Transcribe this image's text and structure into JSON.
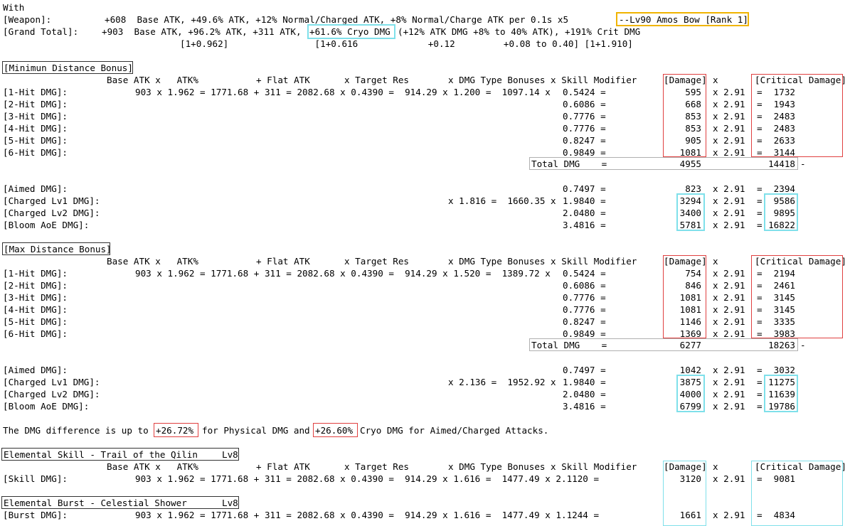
{
  "header": {
    "with": "With",
    "weapon_label": "[Weapon]:",
    "weapon_value": "+608  Base ATK, +49.6% ATK, +12% Normal/Charged ATK, +8% Normal/Charge ATK per 0.1s x5",
    "weapon_name": "--Lv90 Amos Bow [Rank 1]",
    "grand_label": "[Grand Total]:",
    "grand_a": "+903  Base ATK, +96.2% ATK, +311 ATK,",
    "grand_cryo": "+61.6% Cryo DMG",
    "grand_b": "(+12% ATK DMG +8% to 40% ATK), +191% Crit DMG",
    "mult_line": "[1+0.962]                [1+0.616             +0.12         +0.08 to 0.40] [1+1.910]"
  },
  "columns": {
    "base": "Base ATK x   ATK%",
    "flat": "+ Flat ATK",
    "res": "x Target Res",
    "dmgtype": "x DMG Type Bonuses x Skill Modifier",
    "damage": "[Damage]",
    "x": "x",
    "crit": "[Critical Damage]"
  },
  "sections": {
    "min": {
      "title": "[Minimun Distance Bonus]",
      "calc": "903 x 1.962 = 1771.68 + 311 = 2082.68 x 0.4390 =  914.29 x 1.200 =  1097.14 x",
      "rows": [
        {
          "label": "[1-Hit DMG]:",
          "mod": "0.5424 =",
          "dmg": "595",
          "mul": "x 2.91",
          "eq": "=",
          "crit": "1732"
        },
        {
          "label": "[2-Hit DMG]:",
          "mod": "0.6086 =",
          "dmg": "668",
          "mul": "x 2.91",
          "eq": "=",
          "crit": "1943"
        },
        {
          "label": "[3-Hit DMG]:",
          "mod": "0.7776 =",
          "dmg": "853",
          "mul": "x 2.91",
          "eq": "=",
          "crit": "2483"
        },
        {
          "label": "[4-Hit DMG]:",
          "mod": "0.7776 =",
          "dmg": "853",
          "mul": "x 2.91",
          "eq": "=",
          "crit": "2483"
        },
        {
          "label": "[5-Hit DMG]:",
          "mod": "0.8247 =",
          "dmg": "905",
          "mul": "x 2.91",
          "eq": "=",
          "crit": "2633"
        },
        {
          "label": "[6-Hit DMG]:",
          "mod": "0.9849 =",
          "dmg": "1081",
          "mul": "x 2.91",
          "eq": "=",
          "crit": "3144"
        }
      ],
      "total": {
        "label": "Total DMG    =",
        "dmg": "4955",
        "crit": "14418",
        "dash": "-"
      },
      "charged_calc": "x 1.816 =  1660.35 x",
      "charged": [
        {
          "label": "[Aimed DMG]:",
          "mod": "0.7497 =",
          "dmg": "823",
          "mul": "x 2.91",
          "eq": "=",
          "crit": "2394"
        },
        {
          "label": "[Charged Lv1 DMG]:",
          "mod": "1.9840 =",
          "dmg": "3294",
          "mul": "x 2.91",
          "eq": "=",
          "crit": "9586"
        },
        {
          "label": "[Charged Lv2 DMG]:",
          "mod": "2.0480 =",
          "dmg": "3400",
          "mul": "x 2.91",
          "eq": "=",
          "crit": "9895"
        },
        {
          "label": "[Bloom AoE DMG]:",
          "mod": "3.4816 =",
          "dmg": "5781",
          "mul": "x 2.91",
          "eq": "=",
          "crit": "16822"
        }
      ]
    },
    "max": {
      "title": "[Max Distance Bonus]",
      "calc": "903 x 1.962 = 1771.68 + 311 = 2082.68 x 0.4390 =  914.29 x 1.520 =  1389.72 x",
      "rows": [
        {
          "label": "[1-Hit DMG]:",
          "mod": "0.5424 =",
          "dmg": "754",
          "mul": "x 2.91",
          "eq": "=",
          "crit": "2194"
        },
        {
          "label": "[2-Hit DMG]:",
          "mod": "0.6086 =",
          "dmg": "846",
          "mul": "x 2.91",
          "eq": "=",
          "crit": "2461"
        },
        {
          "label": "[3-Hit DMG]:",
          "mod": "0.7776 =",
          "dmg": "1081",
          "mul": "x 2.91",
          "eq": "=",
          "crit": "3145"
        },
        {
          "label": "[4-Hit DMG]:",
          "mod": "0.7776 =",
          "dmg": "1081",
          "mul": "x 2.91",
          "eq": "=",
          "crit": "3145"
        },
        {
          "label": "[5-Hit DMG]:",
          "mod": "0.8247 =",
          "dmg": "1146",
          "mul": "x 2.91",
          "eq": "=",
          "crit": "3335"
        },
        {
          "label": "[6-Hit DMG]:",
          "mod": "0.9849 =",
          "dmg": "1369",
          "mul": "x 2.91",
          "eq": "=",
          "crit": "3983"
        }
      ],
      "total": {
        "label": "Total DMG    =",
        "dmg": "6277",
        "crit": "18263",
        "dash": "-"
      },
      "charged_calc": "x 2.136 =  1952.92 x",
      "charged": [
        {
          "label": "[Aimed DMG]:",
          "mod": "0.7497 =",
          "dmg": "1042",
          "mul": "x 2.91",
          "eq": "=",
          "crit": "3032"
        },
        {
          "label": "[Charged Lv1 DMG]:",
          "mod": "1.9840 =",
          "dmg": "3875",
          "mul": "x 2.91",
          "eq": "=",
          "crit": "11275"
        },
        {
          "label": "[Charged Lv2 DMG]:",
          "mod": "2.0480 =",
          "dmg": "4000",
          "mul": "x 2.91",
          "eq": "=",
          "crit": "11639"
        },
        {
          "label": "[Bloom AoE DMG]:",
          "mod": "3.4816 =",
          "dmg": "6799",
          "mul": "x 2.91",
          "eq": "=",
          "crit": "19786"
        }
      ]
    }
  },
  "difference": {
    "a": "The DMG difference is up to",
    "phys": "+26.72%",
    "b": "for Physical DMG and",
    "cryo": "+26.60%",
    "c": "Cryo DMG for Aimed/Charged Attacks."
  },
  "skill": {
    "title": "Elemental Skill - Trail of the Qilin",
    "level": "Lv8",
    "row": {
      "label": "[Skill DMG]:",
      "calc": "903 x 1.962 = 1771.68 + 311 = 2082.68 x 0.4390 =  914.29 x 1.616 =  1477.49 x 2.1120 =",
      "dmg": "3120",
      "mul": "x 2.91",
      "eq": "=",
      "crit": "9081"
    }
  },
  "burst": {
    "title": "Elemental Burst - Celestial Shower",
    "level": "Lv8",
    "row": {
      "label": "[Burst DMG]:",
      "calc": "903 x 1.962 = 1771.68 + 311 = 2082.68 x 0.4390 =  914.29 x 1.616 =  1477.49 x 1.1244 =",
      "dmg": "1661",
      "mul": "x 2.91",
      "eq": "=",
      "crit": "4834"
    }
  }
}
